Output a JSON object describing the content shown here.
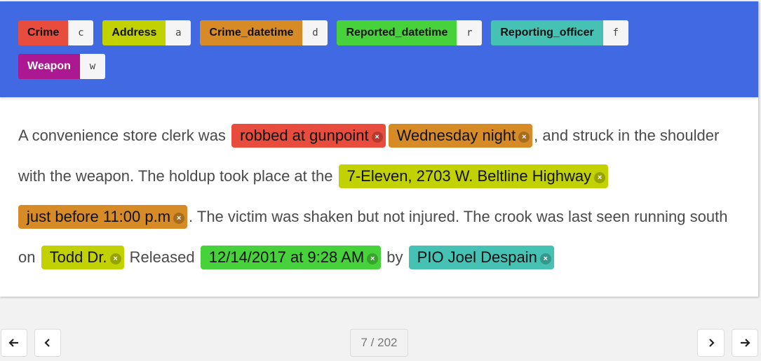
{
  "labels": [
    {
      "name": "Crime",
      "key": "c",
      "color": "#e74c3c"
    },
    {
      "name": "Address",
      "key": "a",
      "color": "#c2d100"
    },
    {
      "name": "Crime_datetime",
      "key": "d",
      "color": "#d68b27"
    },
    {
      "name": "Reported_datetime",
      "key": "r",
      "color": "#47d13a"
    },
    {
      "name": "Reporting_officer",
      "key": "f",
      "color": "#46c2b5"
    },
    {
      "name": "Weapon",
      "key": "w",
      "color": "#ab1892",
      "text_color": "#ffffff"
    }
  ],
  "text": {
    "t0": "A convenience store clerk was",
    "e0": "robbed at gunpoint",
    "e1": "Wednesday night",
    "t1": ", and struck in the shoulder with the weapon. The holdup took place at the",
    "e2": "7-Eleven, 2703 W. Beltline Highway",
    "e3": "just before 11:00 p.m",
    "t2": ". The victim was shaken but not injured. The crook was last seen running south on",
    "e4": "Todd Dr.",
    "t3": "Released",
    "e5": "12/14/2017 at 9:28 AM",
    "t4": "by",
    "e6": "PIO Joel Despain",
    "remove_glyph": "×"
  },
  "entities": [
    {
      "text": "robbed at gunpoint",
      "label": "Crime"
    },
    {
      "text": "Wednesday night",
      "label": "Crime_datetime"
    },
    {
      "text": "7-Eleven, 2703 W. Beltline Highway",
      "label": "Address"
    },
    {
      "text": "just before 11:00 p.m",
      "label": "Crime_datetime"
    },
    {
      "text": "Todd Dr.",
      "label": "Address"
    },
    {
      "text": "12/14/2017 at 9:28 AM",
      "label": "Reported_datetime"
    },
    {
      "text": "PIO Joel Despain",
      "label": "Reporting_officer"
    }
  ],
  "pagination": {
    "current": 7,
    "total": 202,
    "display": "7 / 202",
    "first_icon": "arrow-left-icon",
    "prev_icon": "chevron-left-icon",
    "next_icon": "chevron-right-icon",
    "last_icon": "arrow-right-icon"
  }
}
